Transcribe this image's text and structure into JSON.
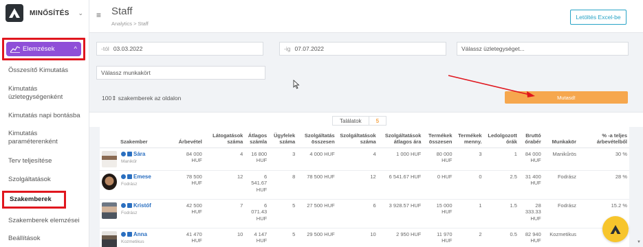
{
  "brand": {
    "name": "MINŐSÍTÉS",
    "caret": "⌄"
  },
  "sidebar": {
    "group_label": "Elemzések",
    "group_caret": "^",
    "items": [
      {
        "label": "Összesítő Kimutatás"
      },
      {
        "label": "Kimutatás üzletegységenként"
      },
      {
        "label": "Kimutatás napi bontásba"
      },
      {
        "label": "Kimutatás paraméterenként"
      },
      {
        "label": "Terv teljesítése"
      },
      {
        "label": "Szolgáltatások"
      },
      {
        "label": "Szakemberek"
      },
      {
        "label": "Szakemberek elemzései"
      },
      {
        "label": "Beállítások"
      }
    ]
  },
  "header": {
    "title": "Staff",
    "breadcrumb": "Analytics > Staff",
    "excel_button": "Letöltés Excel-be"
  },
  "filters": {
    "from_prefix": "-tól",
    "from_value": "03.03.2022",
    "to_prefix": "-ig",
    "to_value": "07.07.2022",
    "unit_placeholder": "Válassz üzletegységet...",
    "job_placeholder": "Válassz munkakört",
    "per_page_value": "100",
    "per_page_label": "szakemberek az oldalon",
    "show_button": "Mutasd!"
  },
  "results": {
    "label": "Találatok",
    "count": "5"
  },
  "table": {
    "columns": [
      "Szakember",
      "Árbevétel",
      "Látogatások száma",
      "Átlagos számla",
      "Ügyfelek száma",
      "Szolgáltatás összesen",
      "Szolgáltatások száma",
      "Szolgáltatások átlagos ára",
      "Termékek összesen",
      "Termékek menny.",
      "Ledolgozott órák",
      "Bruttó órabér",
      "Munkakör",
      "% -a teljes árbevételből"
    ],
    "rows": [
      {
        "name": "Sára",
        "role": "Manikűr",
        "cells": [
          "84 000 HUF",
          "4",
          "16 800 HUF",
          "3",
          "4 000 HUF",
          "4",
          "1 000 HUF",
          "80 000 HUF",
          "3",
          "1",
          "84 000 HUF",
          "Manikűrös",
          "30 %"
        ]
      },
      {
        "name": "Emese",
        "role": "Fodrász",
        "cells": [
          "78 500 HUF",
          "12",
          "6 541.67 HUF",
          "8",
          "78 500 HUF",
          "12",
          "6 541.67 HUF",
          "0 HUF",
          "0",
          "2.5",
          "31 400 HUF",
          "Fodrász",
          "28 %"
        ]
      },
      {
        "name": "Kristóf",
        "role": "Fodrász",
        "cells": [
          "42 500 HUF",
          "7",
          "6 071.43 HUF",
          "5",
          "27 500 HUF",
          "6",
          "3 928.57 HUF",
          "15 000 HUF",
          "1",
          "1.5",
          "28 333.33 HUF",
          "Fodrász",
          "15.2 %"
        ]
      },
      {
        "name": "Anna",
        "role": "Kozmetikus",
        "cells": [
          "41 470 HUF",
          "10",
          "4 147 HUF",
          "5",
          "29 500 HUF",
          "10",
          "2 950 HUF",
          "11 970 HUF",
          "2",
          "0.5",
          "82 940 HUF",
          "Kozmetikus",
          ""
        ]
      }
    ]
  },
  "colors": {
    "accent_purple": "#8f4fd8",
    "accent_orange": "#f6a74e",
    "link_blue": "#2a6fc0",
    "highlight_red": "#e0161e",
    "fab_yellow": "#f7c52c"
  },
  "icons": [
    "logo-icon",
    "hamburger-icon",
    "chart-icon",
    "cursor-icon",
    "red-arrow",
    "info-icon",
    "card-icon"
  ]
}
